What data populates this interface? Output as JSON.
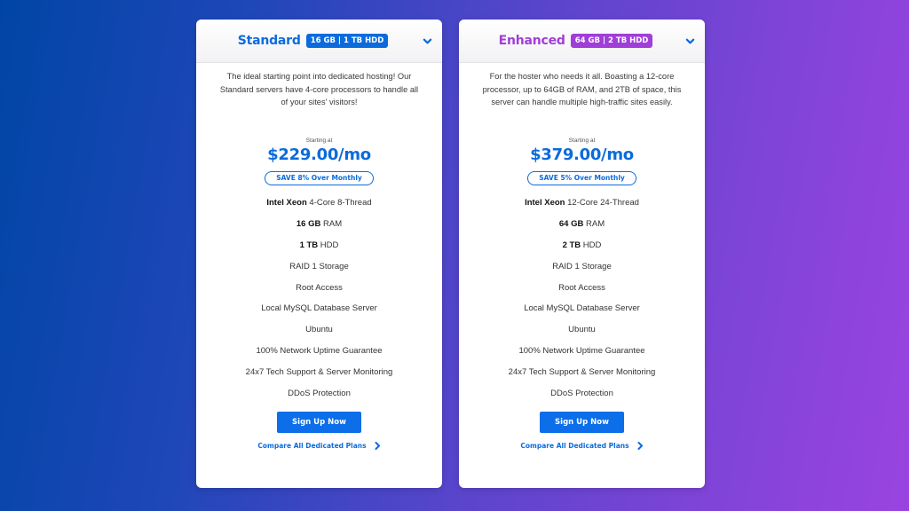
{
  "colors": {
    "standard_accent": "#0c6bdc",
    "enhanced_accent": "#a03ed8",
    "button": "#0c6ee8"
  },
  "plans": [
    {
      "name": "Standard",
      "badge": "16 GB | 1 TB HDD",
      "description": "The ideal starting point into dedicated hosting! Our Standard servers have 4-core processors to handle all of your sites' visitors!",
      "starting_label": "Starting at",
      "price": "$229.00/mo",
      "save_label": "SAVE 8% Over Monthly",
      "features": [
        {
          "bold": "Intel Xeon",
          "text": " 4-Core 8-Thread"
        },
        {
          "bold": "16 GB",
          "text": " RAM"
        },
        {
          "bold": "1 TB",
          "text": " HDD"
        },
        {
          "bold": "",
          "text": "RAID 1 Storage"
        },
        {
          "bold": "",
          "text": "Root Access"
        },
        {
          "bold": "",
          "text": "Local MySQL Database Server"
        },
        {
          "bold": "",
          "text": "Ubuntu"
        },
        {
          "bold": "",
          "text": "100% Network Uptime Guarantee"
        },
        {
          "bold": "",
          "text": "24x7 Tech Support & Server Monitoring"
        },
        {
          "bold": "",
          "text": "DDoS Protection"
        }
      ],
      "signup_label": "Sign Up Now",
      "compare_label": "Compare All Dedicated Plans",
      "expand_icon": "chevron-down-icon"
    },
    {
      "name": "Enhanced",
      "badge": "64 GB | 2 TB HDD",
      "description": "For the hoster who needs it all. Boasting a 12-core processor, up to 64GB of RAM, and 2TB of space, this server can handle multiple high-traffic sites easily.",
      "starting_label": "Starting at",
      "price": "$379.00/mo",
      "save_label": "SAVE 5% Over Monthly",
      "features": [
        {
          "bold": "Intel Xeon",
          "text": " 12-Core 24-Thread"
        },
        {
          "bold": "64 GB",
          "text": " RAM"
        },
        {
          "bold": "2 TB",
          "text": " HDD"
        },
        {
          "bold": "",
          "text": "RAID 1 Storage"
        },
        {
          "bold": "",
          "text": "Root Access"
        },
        {
          "bold": "",
          "text": "Local MySQL Database Server"
        },
        {
          "bold": "",
          "text": "Ubuntu"
        },
        {
          "bold": "",
          "text": "100% Network Uptime Guarantee"
        },
        {
          "bold": "",
          "text": "24x7 Tech Support & Server Monitoring"
        },
        {
          "bold": "",
          "text": "DDoS Protection"
        }
      ],
      "signup_label": "Sign Up Now",
      "compare_label": "Compare All Dedicated Plans",
      "expand_icon": "chevron-down-icon"
    }
  ]
}
